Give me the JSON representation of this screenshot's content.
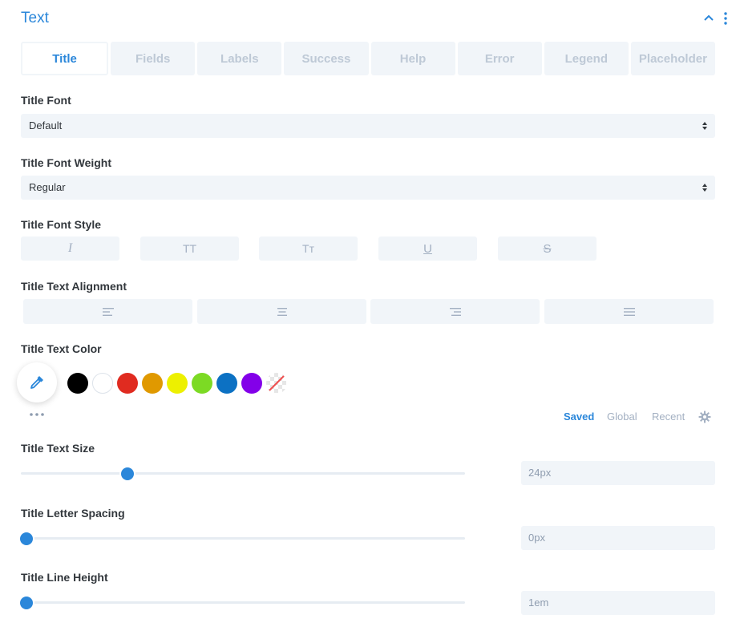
{
  "header": {
    "title": "Text"
  },
  "tabs": [
    {
      "label": "Title",
      "active": true
    },
    {
      "label": "Fields",
      "active": false
    },
    {
      "label": "Labels",
      "active": false
    },
    {
      "label": "Success",
      "active": false
    },
    {
      "label": "Help",
      "active": false
    },
    {
      "label": "Error",
      "active": false
    },
    {
      "label": "Legend",
      "active": false
    },
    {
      "label": "Placeholder",
      "active": false
    }
  ],
  "title_font": {
    "label": "Title Font",
    "value": "Default"
  },
  "title_font_weight": {
    "label": "Title Font Weight",
    "value": "Regular"
  },
  "title_font_style": {
    "label": "Title Font Style",
    "buttons": [
      {
        "icon": "italic-icon",
        "glyph": "I"
      },
      {
        "icon": "uppercase-icon",
        "glyph": "TT"
      },
      {
        "icon": "capitalize-icon",
        "glyph": "Tт"
      },
      {
        "icon": "underline-icon",
        "glyph": "U"
      },
      {
        "icon": "strikethrough-icon",
        "glyph": "S"
      }
    ]
  },
  "title_text_alignment": {
    "label": "Title Text Alignment",
    "options": [
      "align-left-icon",
      "align-center-icon",
      "align-right-icon",
      "align-justify-icon"
    ]
  },
  "title_text_color": {
    "label": "Title Text Color",
    "swatches": [
      "#000000",
      "#ffffff",
      "#e02b20",
      "#e09900",
      "#edf000",
      "#7cda24",
      "#0c71c3",
      "#8300e9",
      "transparent"
    ],
    "palette_tabs": [
      {
        "label": "Saved",
        "active": true
      },
      {
        "label": "Global",
        "active": false
      },
      {
        "label": "Recent",
        "active": false
      }
    ]
  },
  "title_text_size": {
    "label": "Title Text Size",
    "value": "24px",
    "level": 0.24
  },
  "title_letter_spacing": {
    "label": "Title Letter Spacing",
    "value": "0px",
    "level": 0.0
  },
  "title_line_height": {
    "label": "Title Line Height",
    "value": "1em",
    "level": 0.0
  },
  "colors": {
    "accent": "#2b87da",
    "field_bg": "#f1f5f9",
    "muted": "#a3b0c2"
  }
}
